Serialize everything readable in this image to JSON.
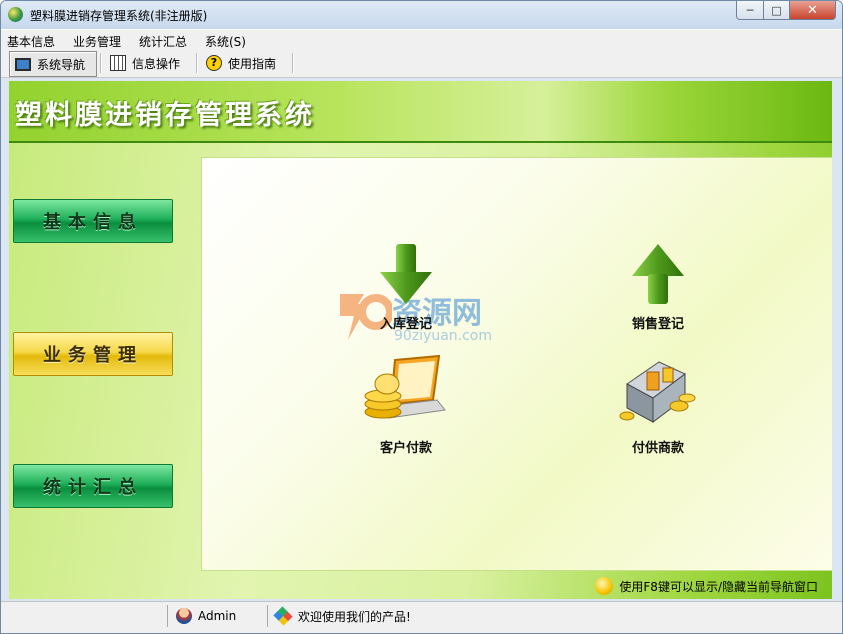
{
  "window": {
    "title": "塑料膜进销存管理系统(非注册版)"
  },
  "menubar": {
    "items": [
      "基本信息",
      "业务管理",
      "统计汇总",
      "系统(S)"
    ]
  },
  "toolbar": {
    "items": [
      {
        "label": "系统导航",
        "icon": "monitor-icon",
        "active": true
      },
      {
        "label": "信息操作",
        "icon": "grid-icon",
        "active": false
      },
      {
        "label": "使用指南",
        "icon": "help-icon",
        "active": false
      }
    ]
  },
  "banner": {
    "title": "塑料膜进销存管理系统"
  },
  "nav": {
    "buttons": [
      {
        "label": "基本信息",
        "color": "#1fb05a"
      },
      {
        "label": "业务管理",
        "color": "#e4b90c"
      },
      {
        "label": "统计汇总",
        "color": "#1fb05a"
      }
    ]
  },
  "functions": [
    {
      "label": "入库登记",
      "icon": "down-arrow-icon"
    },
    {
      "label": "销售登记",
      "icon": "up-arrow-icon"
    },
    {
      "label": "客户付款",
      "icon": "coins-laptop-icon"
    },
    {
      "label": "付供商款",
      "icon": "coins-box-icon"
    }
  ],
  "watermark": {
    "text": "资源网",
    "url": "90ziyuan.com"
  },
  "hint": {
    "text": "使用F8键可以显示/隐藏当前导航窗口"
  },
  "statusbar": {
    "user": "Admin",
    "message": "欢迎使用我们的产品!"
  }
}
